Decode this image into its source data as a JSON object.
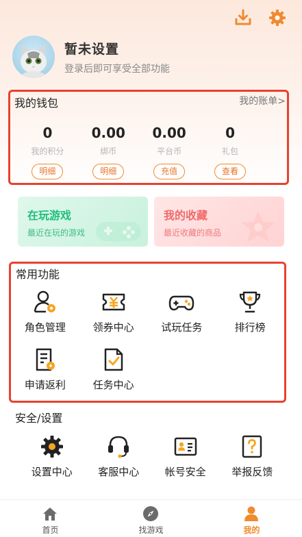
{
  "header": {
    "icons": [
      "download-icon",
      "settings-gear-icon"
    ],
    "accent_color": "#f08a2e"
  },
  "profile": {
    "nickname": "暂未设置",
    "login_tip": "登录后即可享受全部功能"
  },
  "wallet": {
    "title": "我的钱包",
    "bill_link": "我的账单>",
    "items": [
      {
        "value": "0",
        "label": "我的积分",
        "button": "明细"
      },
      {
        "value": "0.00",
        "label": "绑币",
        "button": "明细"
      },
      {
        "value": "0.00",
        "label": "平台币",
        "button": "充值"
      },
      {
        "value": "0",
        "label": "礼包",
        "button": "查看"
      }
    ]
  },
  "cards": {
    "playing": {
      "title": "在玩游戏",
      "subtitle": "最近在玩的游戏"
    },
    "favorites": {
      "title": "我的收藏",
      "subtitle": "最近收藏的商品"
    }
  },
  "common_functions": {
    "title": "常用功能",
    "items": [
      {
        "label": "角色管理",
        "icon": "role-manage-icon"
      },
      {
        "label": "领券中心",
        "icon": "coupon-icon"
      },
      {
        "label": "试玩任务",
        "icon": "gamepad-icon"
      },
      {
        "label": "排行榜",
        "icon": "trophy-icon"
      },
      {
        "label": "申请返利",
        "icon": "rebate-form-icon"
      },
      {
        "label": "任务中心",
        "icon": "task-check-icon"
      }
    ]
  },
  "safety": {
    "title": "安全/设置",
    "items": [
      {
        "label": "设置中心",
        "icon": "settings-icon"
      },
      {
        "label": "客服中心",
        "icon": "headset-icon"
      },
      {
        "label": "帐号安全",
        "icon": "id-card-icon"
      },
      {
        "label": "举报反馈",
        "icon": "report-question-icon"
      }
    ]
  },
  "tabbar": {
    "tabs": [
      {
        "label": "首页",
        "icon": "home-icon",
        "active": false
      },
      {
        "label": "找游戏",
        "icon": "compass-icon",
        "active": false
      },
      {
        "label": "我的",
        "icon": "user-icon",
        "active": true
      }
    ]
  }
}
